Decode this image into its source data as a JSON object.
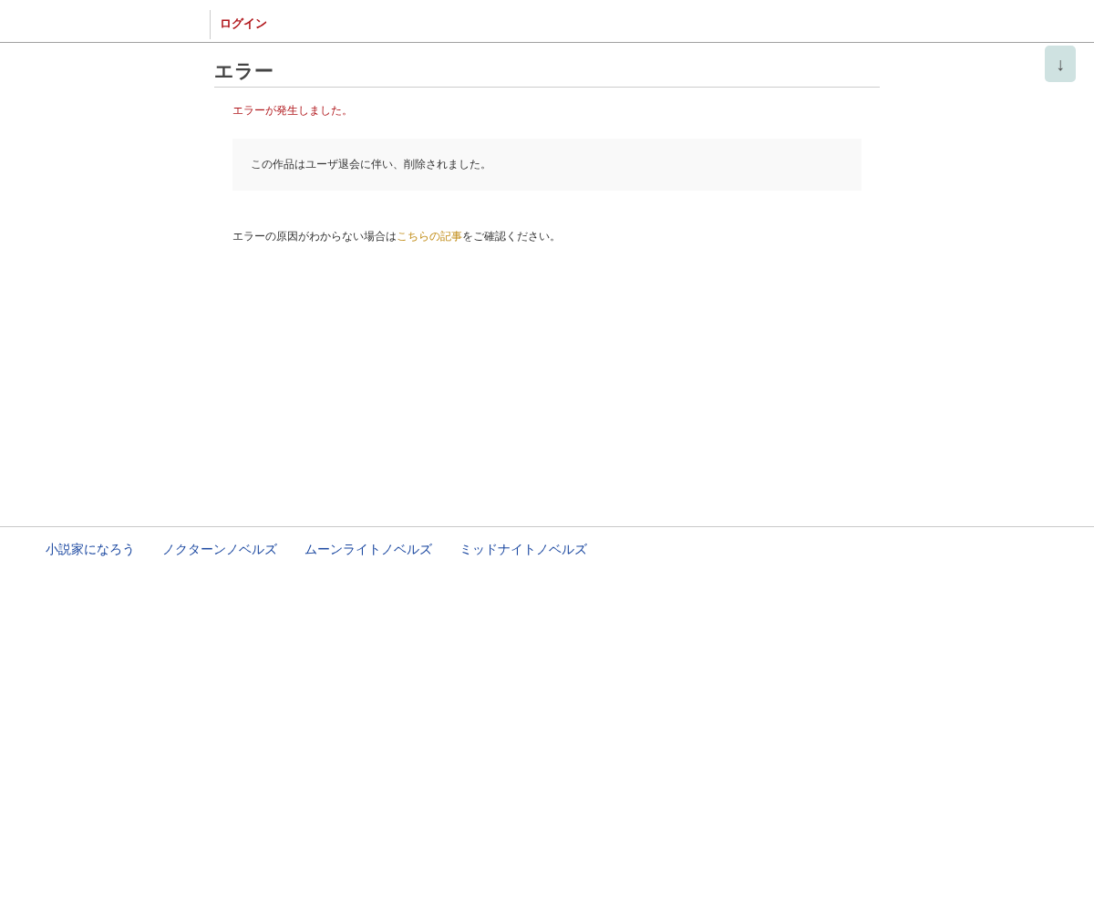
{
  "header": {
    "login_link": "ログイン"
  },
  "scroll_button": {
    "label": "↓"
  },
  "page": {
    "title": "エラー",
    "error_message": "エラーが発生しました。",
    "notice": "この作品はユーザ退会に伴い、削除されました。",
    "help": {
      "before": "エラーの原因がわからない場合は",
      "link": "こちらの記事",
      "after": "をご確認ください。"
    }
  },
  "footer": {
    "links": [
      "小説家になろう",
      "ノクターンノベルズ",
      "ムーンライトノベルズ",
      "ミッドナイトノベルズ"
    ]
  }
}
